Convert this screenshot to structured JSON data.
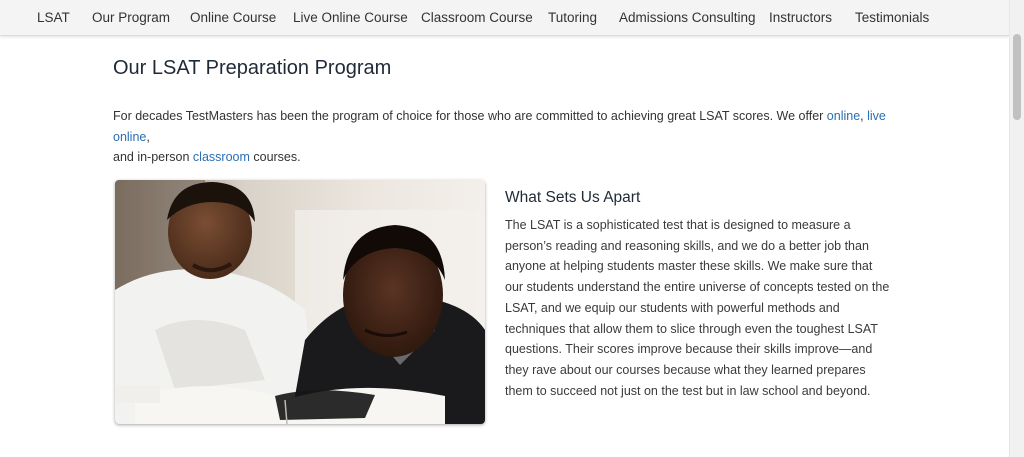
{
  "nav": {
    "items": [
      {
        "label": "LSAT"
      },
      {
        "label": "Our Program"
      },
      {
        "label": "Online Course"
      },
      {
        "label": "Live Online Course"
      },
      {
        "label": "Classroom Course"
      },
      {
        "label": "Tutoring"
      },
      {
        "label": "Admissions Consulting"
      },
      {
        "label": "Instructors"
      },
      {
        "label": "Testimonials"
      }
    ]
  },
  "main": {
    "title": "Our LSAT Preparation Program",
    "intro": {
      "part1": "For decades TestMasters has been the program of choice for those who are committed to achieving great LSAT scores. We offer ",
      "link_online": "online",
      "sep1": ", ",
      "link_live_online": "live online",
      "sep2": ",",
      "part2": "and in-person ",
      "link_classroom": "classroom",
      "part3": " courses."
    },
    "section": {
      "heading": "What Sets Us Apart",
      "body": "The LSAT is a sophisticated test that is designed to measure a person’s reading and reasoning skills, and we do a better job than anyone at helping students master these skills. We make sure that our students understand the entire universe of concepts tested on the LSAT, and we equip our students with powerful methods and techniques that allow them to slice through even the toughest LSAT questions. Their scores improve because their skills improve—and they rave about our courses because what they learned prepares them to succeed not just on the test but in law school and beyond."
    }
  },
  "colors": {
    "link": "#2a6fb3",
    "nav_bg": "#f4f4f4",
    "heading": "#1f2a36"
  }
}
